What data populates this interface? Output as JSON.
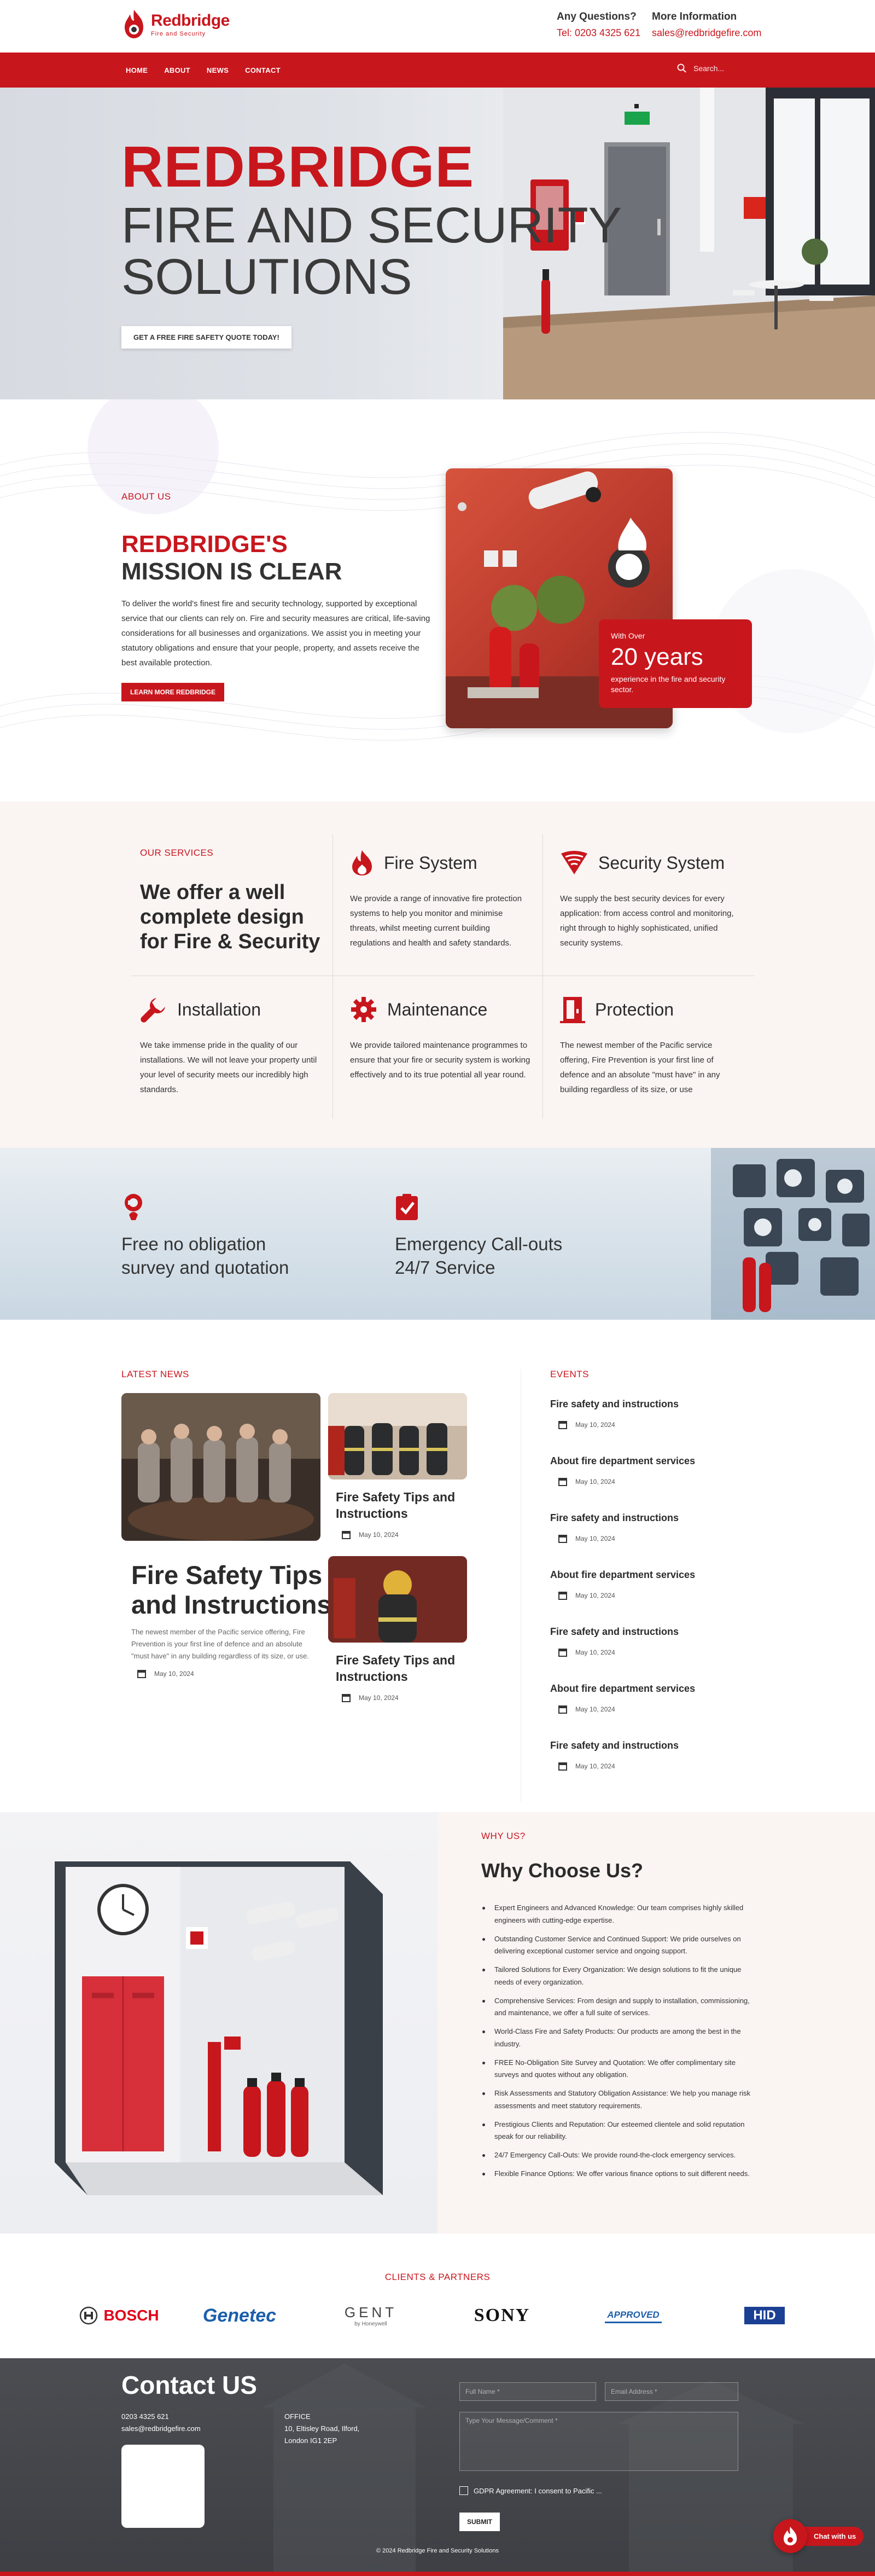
{
  "brand": {
    "name": "Redbridge",
    "tagline": "Fire and Security",
    "accent": "#c8161d"
  },
  "topbar": {
    "questions_label": "Any Questions?",
    "phone": "Tel: 0203 4325 621",
    "info_label": "More Information",
    "email": "sales@redbridgefire.com"
  },
  "nav": {
    "items": [
      "HOME",
      "ABOUT",
      "NEWS",
      "CONTACT"
    ],
    "search_placeholder": "Search..."
  },
  "hero": {
    "title_red": "REDBRIDGE",
    "title_line1": "FIRE AND SECURITY",
    "title_line2": "SOLUTIONS",
    "cta": "GET A FREE FIRE SAFETY QUOTE TODAY!"
  },
  "about": {
    "label": "ABOUT US",
    "title_red": "REDBRIDGE'S",
    "title_dark": "MISSION IS CLEAR",
    "body": "To deliver the world's finest fire and security technology, supported by exceptional service that our clients can rely on. Fire and security measures are critical, life-saving considerations for all businesses and organizations. We assist you in meeting your statutory obligations and ensure that your people, property, and assets receive the best available protection.",
    "button": "LEARN MORE REDBRIDGE",
    "years_small": "With Over",
    "years_big": "20 years",
    "years_desc": "experience in the fire and security sector."
  },
  "services": {
    "label": "OUR SERVICES",
    "heading": "We offer a well complete design for Fire & Security",
    "items": [
      {
        "icon": "flame-icon",
        "title": "Fire System",
        "desc": "We provide a range of innovative fire protection systems to help you monitor and minimise threats, whilst meeting current building regulations and health and safety standards."
      },
      {
        "icon": "wifi-shield-icon",
        "title": "Security System",
        "desc": "We supply the best security devices for every application: from access control and monitoring, right through to highly sophisticated, unified security systems."
      },
      {
        "icon": "wrench-icon",
        "title": "Installation",
        "desc": "We take immense pride in the quality of our installations. We will not leave your property until your level of security meets our incredibly high standards."
      },
      {
        "icon": "gear-icon",
        "title": "Maintenance",
        "desc": "We provide tailored maintenance programmes to ensure that your fire or security system is working effectively and to its true potential all year round."
      },
      {
        "icon": "door-icon",
        "title": "Protection",
        "desc": "The newest member of the Pacific service offering, Fire Prevention is your first line of defence and an absolute \"must have\" in any building regardless of its size, or use"
      }
    ]
  },
  "cta_band": {
    "item1": {
      "icon": "survey-icon",
      "line1": "Free no obligation",
      "line2": "survey and quotation"
    },
    "item2": {
      "icon": "check-box-icon",
      "line1": "Emergency Call-outs",
      "line2": "24/7 Service"
    }
  },
  "news": {
    "label": "LATEST NEWS",
    "featured": {
      "title": "Fire Safety Tips and Instructions",
      "desc": "The newest member of the Pacific service offering, Fire Prevention is your first line of defence and an absolute \"must have\" in any building regardless of its size, or use.",
      "date": "May 10, 2024"
    },
    "side": [
      {
        "title": "Fire Safety Tips and Instructions",
        "date": "May 10, 2024"
      },
      {
        "title": "Fire Safety Tips and Instructions",
        "date": "May 10, 2024"
      }
    ]
  },
  "events": {
    "label": "EVENTS",
    "items": [
      {
        "title": "Fire safety and instructions",
        "date": "May 10, 2024"
      },
      {
        "title": "About fire department services",
        "date": "May 10, 2024"
      },
      {
        "title": "Fire safety and instructions",
        "date": "May 10, 2024"
      },
      {
        "title": "About fire department services",
        "date": "May 10, 2024"
      },
      {
        "title": "Fire safety and instructions",
        "date": "May 10, 2024"
      },
      {
        "title": "About fire department services",
        "date": "May 10, 2024"
      },
      {
        "title": "Fire safety and instructions",
        "date": "May 10, 2024"
      }
    ]
  },
  "why": {
    "label": "WHY US?",
    "title": "Why Choose Us?",
    "items": [
      "Expert Engineers and Advanced Knowledge: Our team comprises highly skilled engineers with cutting-edge expertise.",
      "Outstanding Customer Service and Continued Support: We pride ourselves on delivering exceptional customer service and ongoing support.",
      "Tailored Solutions for Every Organization: We design solutions to fit the unique needs of every organization.",
      "Comprehensive Services: From design and supply to installation, commissioning, and maintenance, we offer a full suite of services.",
      "World-Class Fire and Safety Products: Our products are among the best in the industry.",
      "FREE No-Obligation Site Survey and Quotation: We offer complimentary site surveys and quotes without any obligation.",
      "Risk Assessments and Statutory Obligation Assistance: We help you manage risk assessments and meet statutory requirements.",
      "Prestigious Clients and Reputation: Our esteemed clientele and solid reputation speak for our reliability.",
      "24/7 Emergency Call-Outs: We provide round-the-clock emergency services.",
      "Flexible Finance Options: We offer various finance options to suit different needs."
    ]
  },
  "clients": {
    "label": "CLIENTS & PARTNERS",
    "logos": [
      "BOSCH",
      "Genetec",
      "GENT",
      "SONY",
      "APPROVED",
      "HID"
    ],
    "gent_sub": "by Honeywell"
  },
  "footer": {
    "title": "Contact US",
    "phone": "0203 4325 621",
    "email": "sales@redbridgefire.com",
    "office_label": "OFFICE",
    "address_line1": "10, Eltisley Road, Ilford,",
    "address_line2": "London IG1 2EP",
    "full_name_placeholder": "Full Name *",
    "email_placeholder": "Email Address *",
    "message_placeholder": "Type Your Message/Comment *",
    "gdpr": "GDPR Agreement: I consent to Pacific ...",
    "submit": "SUBMIT",
    "copyright": "© 2024 Redbridge Fire and Security Solutions",
    "chat": "Chat with us"
  }
}
